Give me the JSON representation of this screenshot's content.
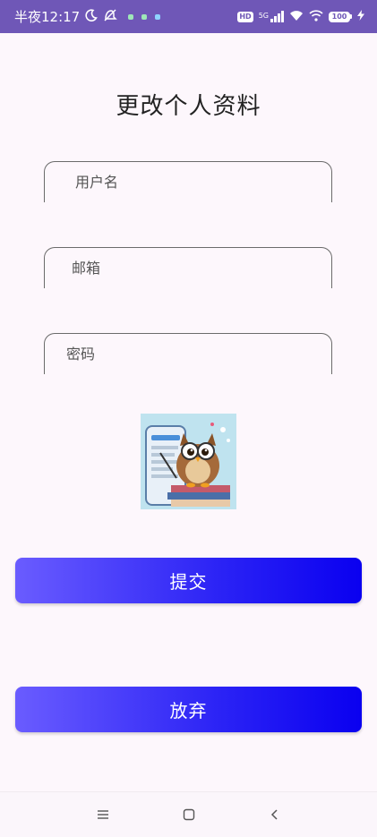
{
  "status_bar": {
    "time_text": "半夜12:17",
    "network_badge": "HD",
    "network_type": "5G",
    "battery_level": "100",
    "icons": [
      "moon-icon",
      "do-not-disturb-icon",
      "notification-dot-icon",
      "signal-icon",
      "wifi-icon",
      "battery-icon",
      "charging-icon"
    ]
  },
  "page": {
    "title": "更改个人资料"
  },
  "form": {
    "username_placeholder": "用户名",
    "email_placeholder": "邮箱",
    "password_placeholder": "密码"
  },
  "actions": {
    "submit_label": "提交",
    "cancel_label": "放弃"
  },
  "colors": {
    "status_bar": "#6f57b7",
    "background": "#fdf7fc",
    "button_gradient_start": "#6a5cff",
    "button_gradient_end": "#0a00f0",
    "button_text": "#ffffff"
  },
  "navigation": {
    "icons": [
      "menu-icon",
      "home-square-icon",
      "back-chevron-icon"
    ]
  }
}
